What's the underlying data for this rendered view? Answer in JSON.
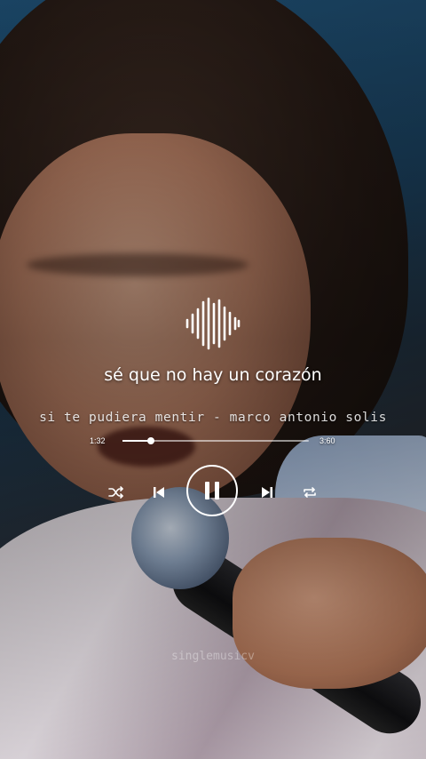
{
  "player": {
    "lyric_line": "sé que no hay un corazón",
    "song_title": "si te pudiera mentir - marco antonio solis",
    "current_time": "1:32",
    "total_time": "3:60",
    "progress_fraction": 0.15,
    "is_playing": true
  },
  "controls": {
    "shuffle_icon": "shuffle-icon",
    "previous_icon": "skip-previous-icon",
    "play_pause_icon": "pause-icon",
    "next_icon": "skip-next-icon",
    "repeat_icon": "repeat-icon"
  },
  "watermark": "singlemusicv",
  "colors": {
    "overlay_text": "#ffffff",
    "background_top": "#1e4f73"
  }
}
